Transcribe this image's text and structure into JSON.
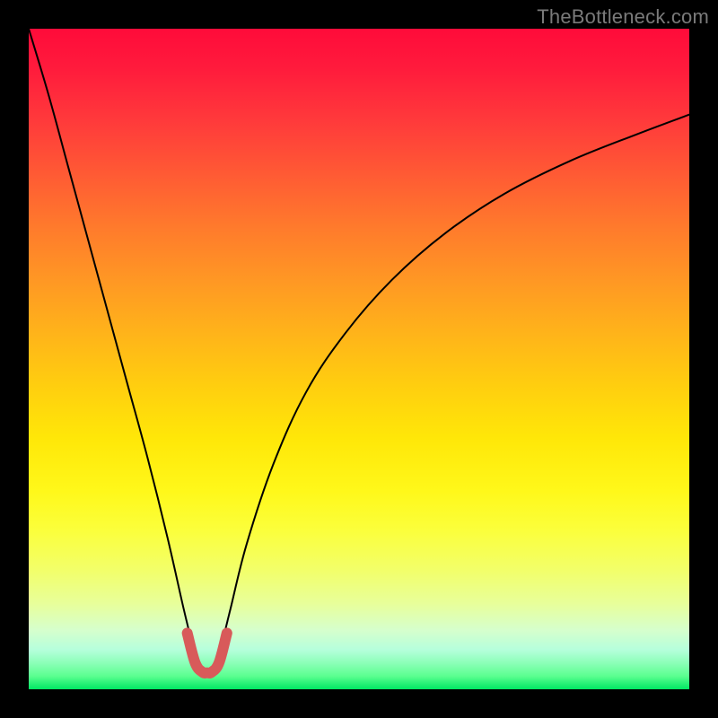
{
  "watermark": "TheBottleneck.com",
  "chart_data": {
    "type": "line",
    "title": "",
    "xlabel": "",
    "ylabel": "",
    "xlim": [
      0,
      100
    ],
    "ylim": [
      0,
      100
    ],
    "grid": false,
    "notch": {
      "x": 27,
      "width_pct": 6,
      "floor_y": 3
    },
    "series": [
      {
        "name": "curve",
        "stroke": "#000000",
        "stroke_width": 2,
        "x": [
          0,
          3,
          6,
          9,
          12,
          15,
          18,
          21,
          23.5,
          25,
          26,
          27,
          28,
          29,
          30.5,
          33,
          37,
          42,
          48,
          55,
          63,
          72,
          82,
          92,
          100
        ],
        "y": [
          100,
          90,
          79,
          68,
          57,
          46,
          35,
          23,
          12,
          6,
          3,
          2.5,
          3,
          6,
          12,
          22,
          34,
          45,
          54,
          62,
          69,
          75,
          80,
          84,
          87
        ]
      },
      {
        "name": "notch-highlight",
        "stroke": "#d85a5a",
        "stroke_width": 12,
        "x": [
          24,
          25.2,
          26.3,
          27,
          27.7,
          28.8,
          30
        ],
        "y": [
          8.5,
          4.0,
          2.6,
          2.5,
          2.6,
          4.0,
          8.5
        ]
      }
    ]
  }
}
